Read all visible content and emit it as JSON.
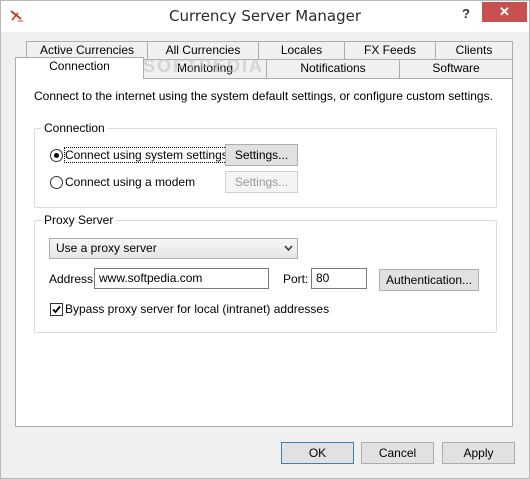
{
  "window": {
    "title": "Currency Server Manager",
    "help_label": "?",
    "close_label": "✕",
    "accent": "#c75050"
  },
  "watermark": "SOFTPEDIA",
  "tabs_row1": [
    "Active Currencies",
    "All Currencies",
    "Locales",
    "FX Feeds",
    "Clients"
  ],
  "tabs_row2": [
    "Connection",
    "Monitoring",
    "Notifications",
    "Software"
  ],
  "active_tab": "Connection",
  "intro_text": "Connect to the internet using the system default settings, or configure custom settings.",
  "connection_group": {
    "label": "Connection",
    "option1": "Connect using system settings",
    "option2": "Connect using a modem",
    "settings_label": "Settings...",
    "selected": "option1"
  },
  "proxy_group": {
    "label": "Proxy Server",
    "proxy_mode": "Use a proxy server",
    "address_label": "Address:",
    "address_value": "www.softpedia.com",
    "port_label": "Port:",
    "port_value": "80",
    "auth_label": "Authentication...",
    "bypass_label": "Bypass proxy server for local (intranet) addresses",
    "bypass_checked": true
  },
  "footer": {
    "ok": "OK",
    "cancel": "Cancel",
    "apply": "Apply"
  }
}
